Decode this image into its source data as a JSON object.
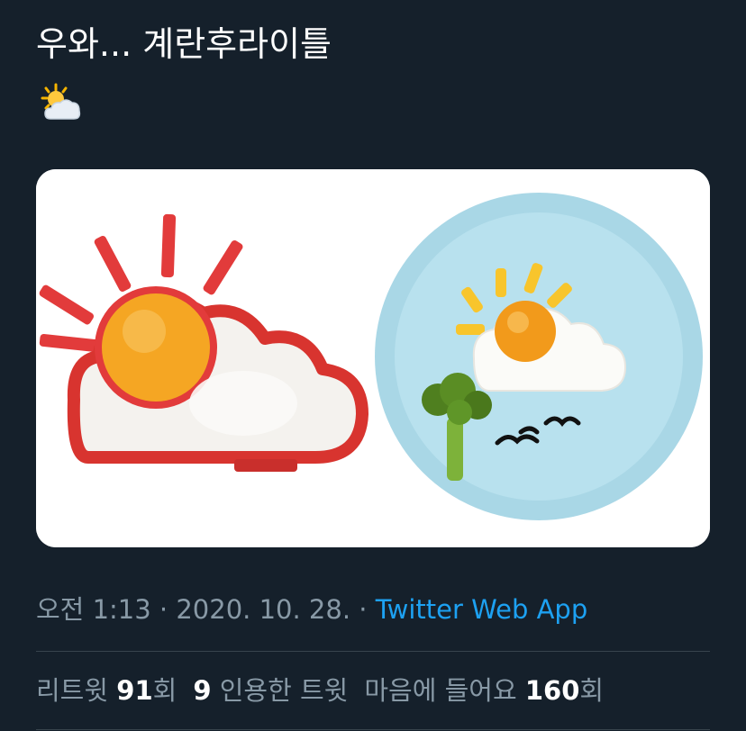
{
  "tweet": {
    "text": "우와... 계란후라이틀",
    "emoji_icon": "sun-behind-cloud-icon"
  },
  "media": {
    "icon": "egg-mold-photo"
  },
  "meta": {
    "time": "오전 1:13",
    "separator1": " · ",
    "date": "2020. 10. 28.",
    "separator2": " · ",
    "source": "Twitter Web App"
  },
  "stats": {
    "retweets_label": "리트윗 ",
    "retweets_count": "91",
    "retweets_suffix": "회",
    "quotes_count": "9",
    "quotes_label": " 인용한 트윗",
    "likes_label": "마음에 들어요 ",
    "likes_count": "160",
    "likes_suffix": "회"
  },
  "colors": {
    "background": "#15202b",
    "text": "#ffffff",
    "secondary": "#8899a6",
    "link": "#1da1f2",
    "divider": "#38444d"
  }
}
